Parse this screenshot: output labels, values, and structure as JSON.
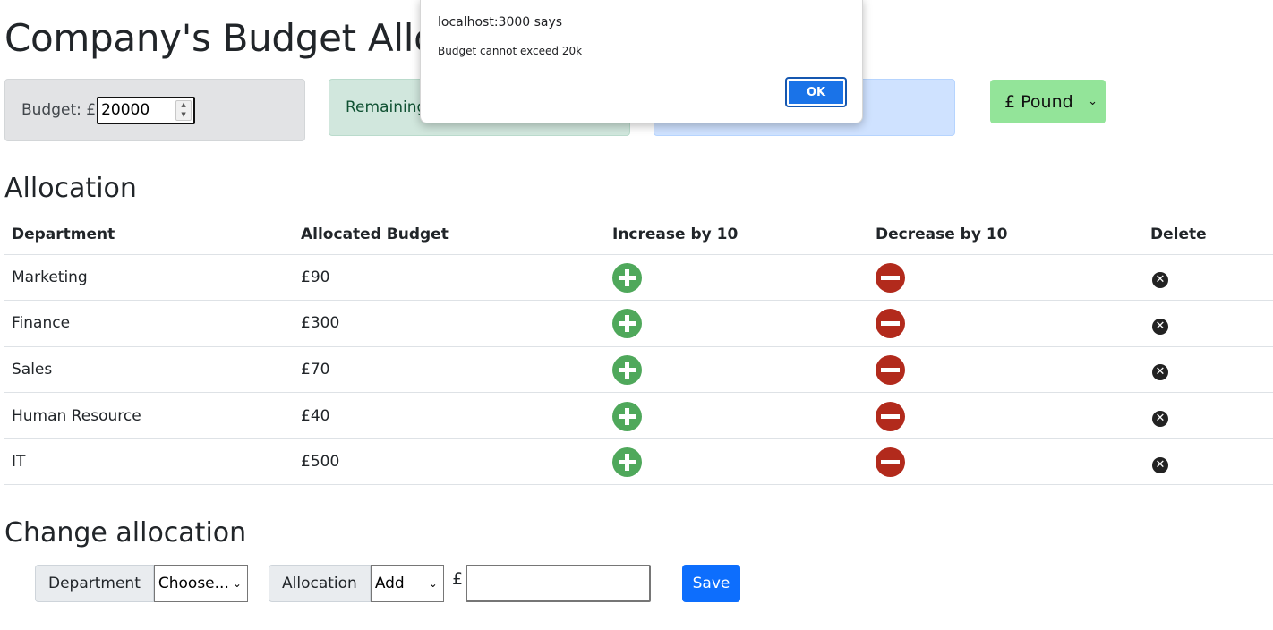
{
  "page": {
    "title": "Company's Budget Allocation"
  },
  "budget": {
    "label": "Budget: £",
    "value": "20000"
  },
  "remaining": {
    "label": "Remaining: £"
  },
  "spent": {
    "label": ""
  },
  "currency": {
    "selected": "£ Pound"
  },
  "allocation": {
    "title": "Allocation",
    "headers": [
      "Department",
      "Allocated Budget",
      "Increase by 10",
      "Decrease by 10",
      "Delete"
    ],
    "rows": [
      {
        "department": "Marketing",
        "budget": "£90"
      },
      {
        "department": "Finance",
        "budget": "£300"
      },
      {
        "department": "Sales",
        "budget": "£70"
      },
      {
        "department": "Human Resource",
        "budget": "£40"
      },
      {
        "department": "IT",
        "budget": "£500"
      }
    ]
  },
  "change": {
    "title": "Change allocation",
    "department_label": "Department",
    "department_value": "Choose...",
    "allocation_label": "Allocation",
    "allocation_value": "Add",
    "currency_symbol": "£",
    "amount_value": "",
    "save_label": "Save"
  },
  "dialog": {
    "title": "localhost:3000 says",
    "message": "Budget cannot exceed 20k",
    "ok_label": "OK"
  },
  "colors": {
    "increase": "#4fa85b",
    "decrease": "#b22a1c",
    "save": "#0d6efd",
    "currency_select": "#93e499"
  }
}
